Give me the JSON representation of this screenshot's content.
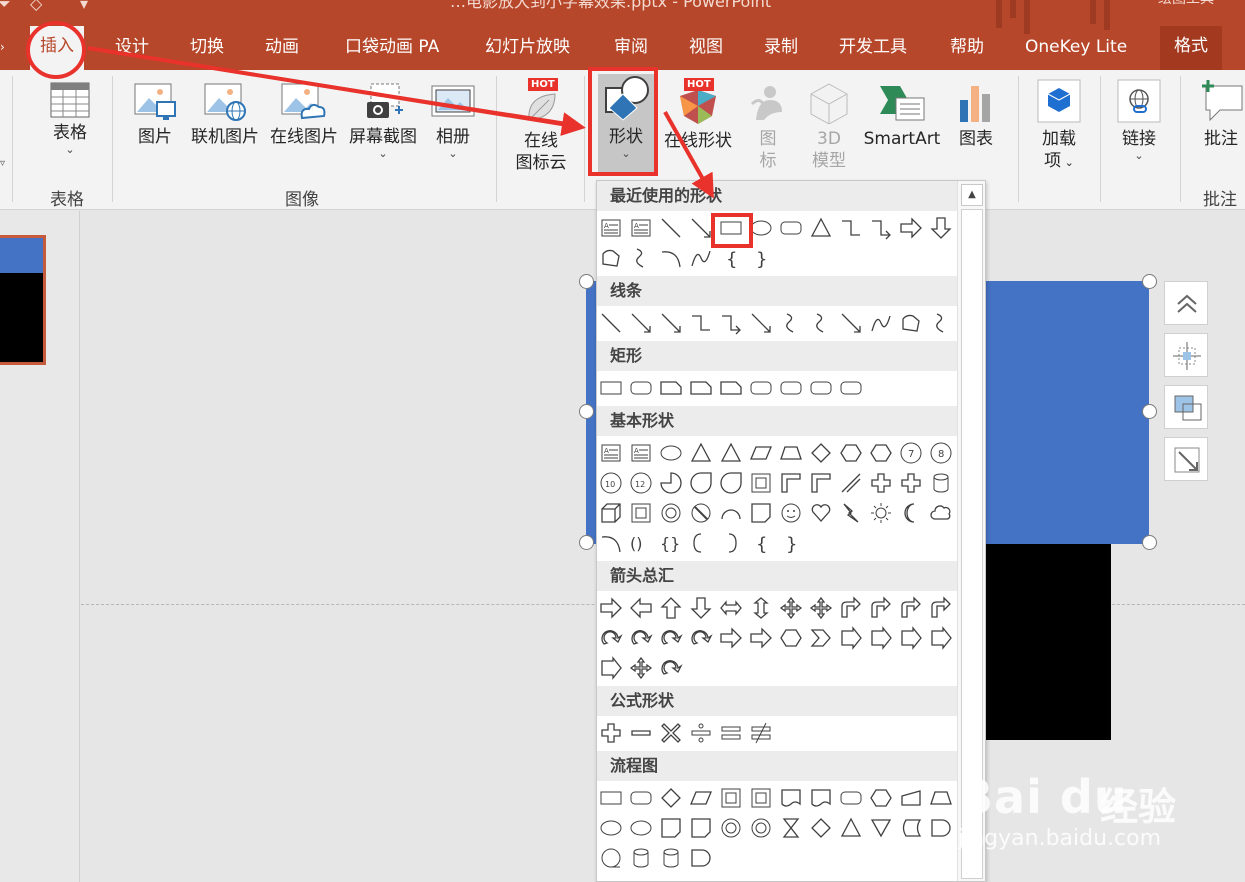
{
  "window": {
    "title": "…电影放大到小字幕效果.pptx - PowerPoint",
    "tools_label": "绘图工具"
  },
  "tabs": [
    {
      "label": "插入",
      "active": true
    },
    {
      "label": "设计"
    },
    {
      "label": "切换"
    },
    {
      "label": "动画"
    },
    {
      "label": "口袋动画 PA"
    },
    {
      "label": "幻灯片放映"
    },
    {
      "label": "审阅"
    },
    {
      "label": "视图"
    },
    {
      "label": "录制"
    },
    {
      "label": "开发工具"
    },
    {
      "label": "帮助"
    },
    {
      "label": "OneKey Lite"
    },
    {
      "label": "格式",
      "contextual": true
    }
  ],
  "ribbon": {
    "groups": {
      "tables": "表格",
      "images": "图像",
      "comments": "批注"
    },
    "buttons": {
      "table": "表格",
      "picture": "图片",
      "online_picture_linked": "联机图片",
      "online_picture": "在线图片",
      "screenshot": "屏幕截图",
      "album": "相册",
      "icon_cloud_line1": "在线",
      "icon_cloud_line2": "图标云",
      "shapes": "形状",
      "online_shapes": "在线形状",
      "icons_line1": "图",
      "icons_line2": "标",
      "model3d_line1": "3D",
      "model3d_line2": "模型",
      "smartart": "SmartArt",
      "chart": "图表",
      "addins_line1": "加载",
      "addins_line2": "项",
      "link": "链接",
      "comment": "批注"
    },
    "hot_badge": "HOT"
  },
  "shapes_menu": {
    "categories": [
      {
        "label": "最近使用的形状",
        "rows": [
          [
            "textbox",
            "vertical-textbox",
            "line",
            "line-arrow",
            "rectangle",
            "oval",
            "rounded-rectangle",
            "triangle",
            "elbow-connector",
            "elbow-arrow-connector",
            "right-arrow",
            "down-arrow"
          ],
          [
            "freeform",
            "scribble",
            "arc",
            "curve",
            "left-brace",
            "right-brace"
          ]
        ]
      },
      {
        "label": "线条",
        "rows": [
          [
            "line",
            "line-arrow",
            "double-arrow",
            "elbow-connector",
            "elbow-arrow",
            "elbow-double-arrow",
            "curved-connector",
            "curved-arrow",
            "curved-double-arrow",
            "curve",
            "freeform",
            "scribble"
          ]
        ]
      },
      {
        "label": "矩形",
        "rows": [
          [
            "rectangle",
            "rounded-rectangle",
            "snip-single-corner",
            "snip-same-side",
            "snip-diagonal",
            "snip-round",
            "round-single-corner",
            "round-same-side",
            "round-diagonal"
          ]
        ]
      },
      {
        "label": "基本形状",
        "rows": [
          [
            "textbox",
            "vertical-textbox",
            "oval",
            "isosceles-triangle",
            "right-triangle",
            "parallelogram",
            "trapezoid",
            "diamond",
            "pentagon",
            "hexagon",
            "heptagon",
            "octagon"
          ],
          [
            "decagon",
            "dodecagon",
            "pie",
            "chord",
            "teardrop",
            "frame",
            "half-frame",
            "l-shape",
            "diagonal-stripe",
            "cross",
            "plaque",
            "can"
          ],
          [
            "cube",
            "bevel",
            "donut",
            "no-symbol",
            "block-arc",
            "folded-corner",
            "smiley-face",
            "heart",
            "lightning-bolt",
            "sun",
            "moon",
            "cloud"
          ],
          [
            "arc",
            "double-bracket",
            "double-brace",
            "left-bracket",
            "right-bracket",
            "left-brace",
            "right-brace"
          ]
        ]
      },
      {
        "label": "箭头总汇",
        "rows": [
          [
            "right-arrow",
            "left-arrow",
            "up-arrow",
            "down-arrow",
            "left-right-arrow",
            "up-down-arrow",
            "quad-arrow",
            "left-right-up-arrow",
            "bent-arrow",
            "u-turn-arrow",
            "left-up-arrow",
            "bent-up-arrow"
          ],
          [
            "curved-right-arrow",
            "curved-left-arrow",
            "curved-up-arrow",
            "curved-down-arrow",
            "striped-right-arrow",
            "notched-right-arrow",
            "pentagon-arrow",
            "chevron",
            "right-arrow-callout",
            "down-arrow-callout",
            "left-arrow-callout",
            "up-arrow-callout"
          ],
          [
            "left-right-arrow-callout",
            "quad-arrow-callout",
            "circular-arrow"
          ]
        ]
      },
      {
        "label": "公式形状",
        "rows": [
          [
            "plus",
            "minus",
            "multiply",
            "divide",
            "equal",
            "not-equal"
          ]
        ]
      },
      {
        "label": "流程图",
        "rows": [
          [
            "process",
            "alternate-process",
            "decision",
            "data",
            "predefined-process",
            "internal-storage",
            "document",
            "multidocument",
            "terminator",
            "preparation",
            "manual-input",
            "manual-operation"
          ],
          [
            "connector",
            "off-page-connector",
            "card",
            "punched-tape",
            "summing-junction",
            "or",
            "collate",
            "sort",
            "extract",
            "merge",
            "stored-data",
            "delay"
          ],
          [
            "sequential-access-storage",
            "magnetic-disk",
            "direct-access-storage",
            "display"
          ]
        ]
      }
    ]
  },
  "watermark": {
    "brand": "Bai du",
    "site": "jingyan.baidu.com",
    "cn": "经验"
  },
  "colors": {
    "accent": "#b7472a",
    "annotation": "#e8322b",
    "shape_fill": "#4472c4"
  }
}
